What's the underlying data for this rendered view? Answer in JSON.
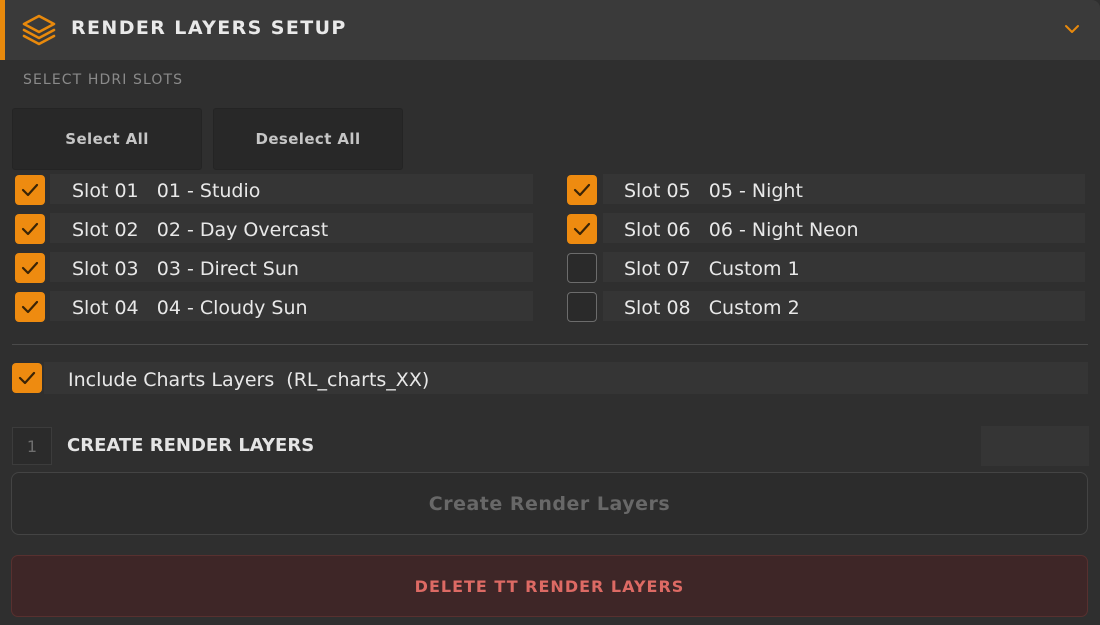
{
  "header": {
    "title": "RENDER LAYERS SETUP",
    "icon": "layers-icon",
    "chevron_icon": "chevron-down-icon",
    "accent_color": "#e8890c"
  },
  "section": {
    "label": "SELECT HDRI SLOTS"
  },
  "buttons": {
    "select_all": "Select All",
    "deselect_all": "Deselect All"
  },
  "slots": [
    {
      "slot": "Slot 01",
      "name": "01 - Studio",
      "checked": true
    },
    {
      "slot": "Slot 02",
      "name": "02 - Day Overcast",
      "checked": true
    },
    {
      "slot": "Slot 03",
      "name": "03 - Direct Sun",
      "checked": true
    },
    {
      "slot": "Slot 04",
      "name": "04 - Cloudy Sun",
      "checked": true
    },
    {
      "slot": "Slot 05",
      "name": "05 - Night",
      "checked": true
    },
    {
      "slot": "Slot 06",
      "name": "06 - Night Neon",
      "checked": true
    },
    {
      "slot": "Slot 07",
      "name": "Custom 1",
      "checked": false
    },
    {
      "slot": "Slot 08",
      "name": "Custom 2",
      "checked": false
    }
  ],
  "charts_option": {
    "label": "Include Charts Layers  (RL_charts_XX)",
    "checked": true
  },
  "step": {
    "number": "1",
    "title": "CREATE RENDER LAYERS"
  },
  "create_button": {
    "label": "Create Render Layers",
    "enabled": false
  },
  "delete_button": {
    "label": "DELETE TT RENDER LAYERS",
    "color": "#dd6a64"
  },
  "colors": {
    "checkbox_on": "#ee8b10",
    "background": "#2f2f2f"
  }
}
